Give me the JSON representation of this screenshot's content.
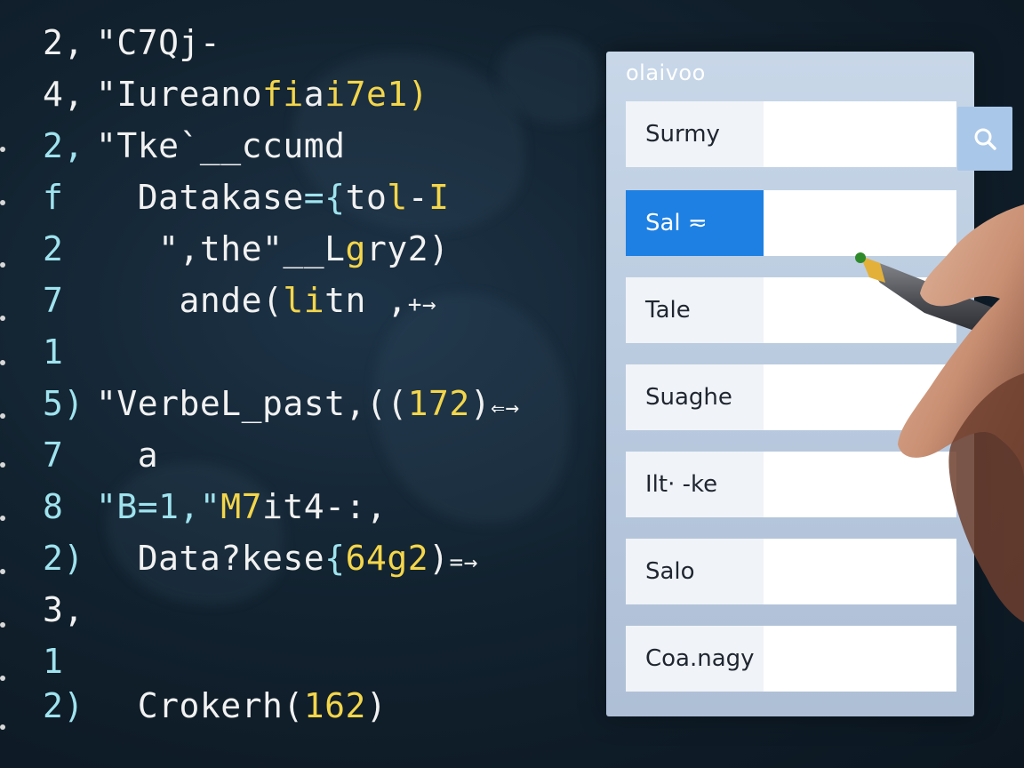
{
  "code": {
    "lines": [
      {
        "ln": "2,",
        "ln_white": true,
        "tokens": [
          {
            "t": "\"C7Qj-",
            "c": ""
          }
        ]
      },
      {
        "ln": "4,",
        "ln_white": true,
        "tokens": [
          {
            "t": "\"Iureano",
            "c": ""
          },
          {
            "t": "fi",
            "c": "hl"
          },
          {
            "t": "a",
            "c": ""
          },
          {
            "t": "i7e1)",
            "c": "hl"
          }
        ]
      },
      {
        "ln": "2,",
        "ln_white": false,
        "tokens": [
          {
            "t": "\"Tke`__ccumd",
            "c": ""
          }
        ]
      },
      {
        "ln": "f",
        "ln_white": false,
        "tokens": [
          {
            "t": "  Datakase",
            "c": ""
          },
          {
            "t": "=",
            "c": "cy"
          },
          {
            "t": "{",
            "c": "cy"
          },
          {
            "t": "to",
            "c": ""
          },
          {
            "t": "l",
            "c": "hl"
          },
          {
            "t": "-",
            "c": ""
          },
          {
            "t": "I",
            "c": "hl"
          }
        ]
      },
      {
        "ln": "2",
        "ln_white": false,
        "tokens": [
          {
            "t": "   ",
            "c": ""
          },
          {
            "t": "\",the\"__L",
            "c": ""
          },
          {
            "t": "g",
            "c": "hl"
          },
          {
            "t": "ry2)",
            "c": ""
          }
        ]
      },
      {
        "ln": "7",
        "ln_white": false,
        "tokens": [
          {
            "t": "    ande(",
            "c": ""
          },
          {
            "t": "li",
            "c": "hl"
          },
          {
            "t": "tn ,",
            "c": ""
          },
          {
            "t": "+→",
            "c": "arrow"
          }
        ]
      },
      {
        "ln": "1",
        "ln_white": false,
        "tokens": []
      },
      {
        "ln": "5)",
        "ln_white": false,
        "tokens": [
          {
            "t": "\"VerbeL_past,((",
            "c": ""
          },
          {
            "t": "172",
            "c": "hl"
          },
          {
            "t": ")",
            "c": ""
          },
          {
            "t": "⇐→",
            "c": "arrow"
          }
        ]
      },
      {
        "ln": "7",
        "ln_white": false,
        "tokens": [
          {
            "t": "  a",
            "c": ""
          }
        ]
      },
      {
        "ln": "8",
        "ln_white": false,
        "tokens": [
          {
            "t": "\"B=1,\"",
            "c": "cy"
          },
          {
            "t": "M7",
            "c": "hl"
          },
          {
            "t": "it4-:,",
            "c": ""
          }
        ]
      },
      {
        "ln": "2)",
        "ln_white": false,
        "tokens": [
          {
            "t": "  Data?kese",
            "c": ""
          },
          {
            "t": "{",
            "c": "cy"
          },
          {
            "t": "64g2",
            "c": "hl"
          },
          {
            "t": ")",
            "c": ""
          },
          {
            "t": "=→",
            "c": "arrow"
          }
        ]
      },
      {
        "ln": "3,",
        "ln_white": true,
        "tokens": []
      },
      {
        "ln": "1",
        "ln_white": false,
        "tokens": []
      },
      {
        "ln": "2)",
        "ln_white": false,
        "tokens": [
          {
            "t": "  Crokerh(",
            "c": ""
          },
          {
            "t": "162",
            "c": "hl"
          },
          {
            "t": ")",
            "c": ""
          }
        ]
      }
    ]
  },
  "dialog": {
    "title": "olaivoo",
    "fields": [
      {
        "label": "Surmy",
        "selected": false
      },
      {
        "label": "Sal ≂",
        "selected": true
      },
      {
        "label": "Tale",
        "selected": false
      },
      {
        "label": "Suaghe",
        "selected": false
      },
      {
        "label": "Ilt· -ke",
        "selected": false
      },
      {
        "label": "Salo",
        "selected": false
      },
      {
        "label": "Coa.nagy",
        "selected": false
      }
    ],
    "search_icon": "search-icon"
  },
  "colors": {
    "background": "#12222f",
    "code_text": "#f1f1f1",
    "code_highlight": "#f4d64a",
    "code_cyan": "#9fe3ee",
    "dialog_bg": "#b9cadf",
    "selected_field": "#1e80e2",
    "search_button": "#a9c7e9"
  }
}
